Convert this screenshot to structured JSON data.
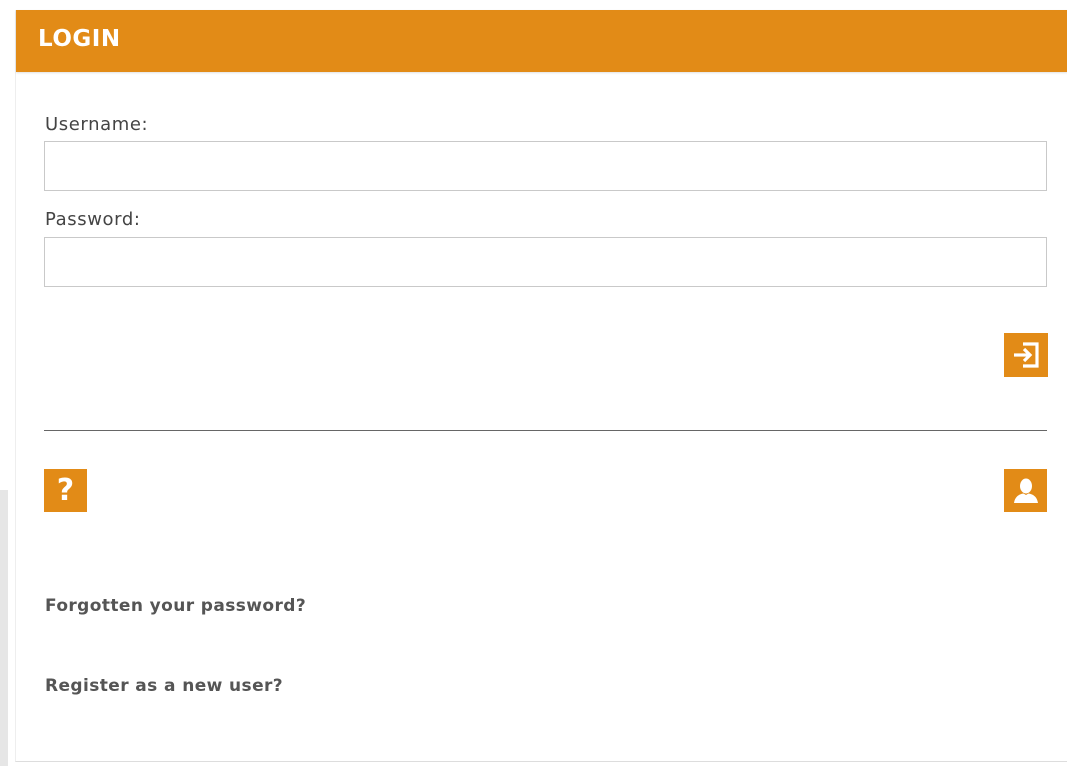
{
  "header": {
    "title": "LOGIN"
  },
  "form": {
    "username_label": "Username:",
    "username_value": "",
    "password_label": "Password:",
    "password_value": ""
  },
  "icons": {
    "login": "sign-in-icon",
    "help": "question-mark-icon",
    "register": "user-icon"
  },
  "links": {
    "forgot_password": "Forgotten your password?",
    "register": "Register as a new user?"
  },
  "colors": {
    "accent": "#e28b17",
    "text": "#444444",
    "link": "#555555",
    "input_border": "#c9c9c9",
    "divider": "#666666"
  }
}
